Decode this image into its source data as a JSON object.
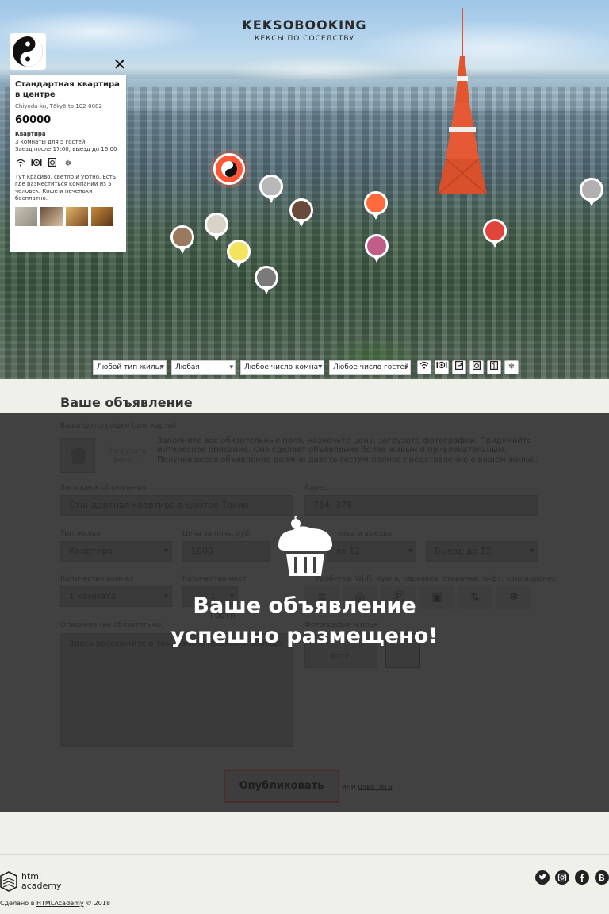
{
  "header": {
    "title": "KEKSOBOOKING",
    "subtitle": "КЕКСЫ ПО СОСЕДСТВУ"
  },
  "popup": {
    "title": "Стандартная квартира в центре",
    "address": "Chiyoda-ku, Tōkyō-to 102-0082",
    "price": "60000",
    "type": "Квартира",
    "capacity": "3 комнаты для 5 гостей",
    "time": "Заезд после 17:00, выезд до 16:00",
    "features": [
      "wifi-icon",
      "dishwasher-icon",
      "washer-icon",
      "conditioner-icon"
    ],
    "description": "Тут красиво, светло и уютно. Есть где разместиться компании из 5 человек. Кофе и печеньки бесплатно.",
    "close_symbol": "✕"
  },
  "filters": {
    "type": "Любой тип жилья",
    "price": "Любая",
    "rooms": "Любое число комнат",
    "guests": "Любое число гостей",
    "features": [
      "wifi-icon",
      "dishwasher-icon",
      "parking-icon",
      "washer-icon",
      "elevator-icon",
      "conditioner-icon"
    ]
  },
  "form": {
    "heading": "Ваше объявление",
    "avatar_label": "Ваша фотография (для карты)",
    "avatar_upload": "Загрузить фото...",
    "hint": "Заполните все обязательные поля, назначьте цену, загрузите фотографии. Придумайте интересное описание. Оно сделает объявление более живым и привлекательным. Получившееся объявление должно давать гостям полное представление о вашем жилье.",
    "title_label": "Заголовок объявления",
    "title_value": "Стандартная квартира в центре Токио",
    "address_label": "Адрес",
    "address_value": "714, 378",
    "type_label": "Тип жилья",
    "type_value": "Квартира",
    "price_label": "Цена за ночь, руб.",
    "price_value": "1000",
    "time_label": "езда и выезда",
    "checkin_value": "ле 12",
    "checkout_value": "Выезд до 12",
    "rooms_label": "Количество комнат",
    "rooms_value": "1 комната",
    "capacity_label": "Количество мест",
    "capacity_value": "1 гостя",
    "features_label": "Удобства: Wi-Fi, кухня, парковка, стиралка, лифт, кондиционер",
    "features": [
      "wifi-icon",
      "dishwasher-icon",
      "parking-icon",
      "washer-icon",
      "elevator-icon",
      "conditioner-icon"
    ],
    "description_label": "Описание (не обязательно)",
    "description_placeholder": "Здесь расскажите о том, замечательное и вообще",
    "photos_label": "Фотография жилья",
    "photos_upload": "фото...",
    "submit": "Опубликовать",
    "or": "или",
    "reset": "очистить"
  },
  "success": {
    "line1": "Ваше объявление",
    "line2": "успешно размещено!"
  },
  "footer": {
    "academy_line1": "html",
    "academy_line2": "academy",
    "made_in": "Сделано в",
    "made_link": "HTMLAcademy",
    "year": "© 2018",
    "socials": [
      "twitter-icon",
      "instagram-icon",
      "facebook-icon",
      "vk-icon"
    ]
  },
  "colors": {
    "accent": "#ff5635",
    "overlay": "#414141",
    "page_bg": "#f0f0ea"
  }
}
